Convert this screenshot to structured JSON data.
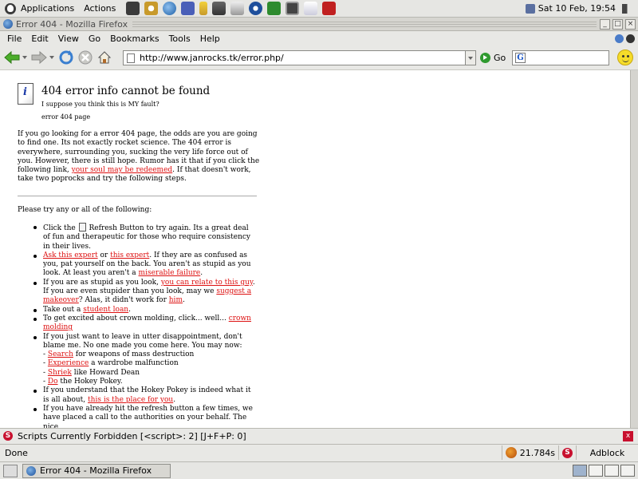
{
  "panel": {
    "applications": "Applications",
    "actions": "Actions",
    "clock": "Sat 10 Feb, 19:54",
    "launchers": [
      "terminal-icon",
      "clock-icon",
      "globe-icon",
      "m-icon",
      "figure-icon",
      "monitor-icon",
      "notepad-icon",
      "fish-icon",
      "money-icon",
      "screen-icon",
      "document-icon",
      "pdf-icon"
    ]
  },
  "window": {
    "title": "Error 404 - Mozilla Firefox"
  },
  "menubar": {
    "items": [
      "File",
      "Edit",
      "View",
      "Go",
      "Bookmarks",
      "Tools",
      "Help"
    ]
  },
  "navbar": {
    "url": "http://www.janrocks.tk/error.php/",
    "go_label": "Go",
    "search_value": ""
  },
  "page": {
    "title": "404 error info cannot be found",
    "subtitle": "I suppose you think this is MY fault?",
    "small": "error 404 page",
    "intro_1": "If you go looking for a error 404 page, the odds are you are going to find one. Its not exactly rocket science. The 404 error is everywhere, surrounding you, sucking the very life force out of you. However, there is still hope. Rumor has it that if you click the following link,",
    "intro_link": "your soul may be redeemed",
    "intro_2": ". If that doesn't work, take two poprocks and try the following steps.",
    "try_text": "Please try any or all of the following:",
    "steps": {
      "s1_a": "Click the",
      "s1_b": "Refresh Button to try again. Its a great deal of fun and therapeutic for those who require consistency in their lives.",
      "s2_link1": "Ask this expert",
      "s2_or": " or ",
      "s2_link2": "this expert",
      "s2_b": ". If they are as confused as you, pat yourself on the back. You aren't as stupid as you look. At least you aren't a",
      "s2_link3": "miserable failure",
      "s2_end": ".",
      "s3_a": "If you are as stupid as you look,",
      "s3_link1": "you can relate to this guy",
      "s3_b": ". If you are even stupider than you look, may we",
      "s3_link2": "suggest a makeover",
      "s3_c": "? Alas, it didn't work for",
      "s3_link3": "him",
      "s3_end": ".",
      "s4_a": "Take out a",
      "s4_link": "student loan",
      "s4_end": ".",
      "s5_a": "To get excited about crown molding, click... well...",
      "s5_link": "crown molding",
      "s6_a": "If you just want to leave in utter disappointment, don't blame me. No one made you come here. You may now:",
      "s6_l1": "Search",
      "s6_t1": " for weapons of mass destruction",
      "s6_l2": "Experience",
      "s6_t2": " a wardrobe malfunction",
      "s6_l3": "Shriek",
      "s6_t3": " like Howard Dean",
      "s6_l4": "Do",
      "s6_t4": " the Hokey Pokey.",
      "dash": "- ",
      "s7_a": "If you understand that the Hokey Pokey is indeed what it is all about,",
      "s7_link": "this is the place for you",
      "s7_end": ".",
      "s8_a": "If you have already hit the refresh button a few times, we have placed a call to the authorities on your behalf. The nice"
    }
  },
  "noscript": {
    "text": "Scripts Currently Forbidden [<script>: 2] [J+F+P: 0]",
    "icon_letter": "S",
    "close": "x"
  },
  "statusbar": {
    "text": "Done",
    "timer": "21.784s",
    "adblock": "Adblock",
    "s_letter": "S"
  },
  "taskbar": {
    "task_label": "Error 404 - Mozilla Firefox"
  },
  "colors": {
    "link": "#dd1111",
    "noscript_red": "#c8102e"
  }
}
